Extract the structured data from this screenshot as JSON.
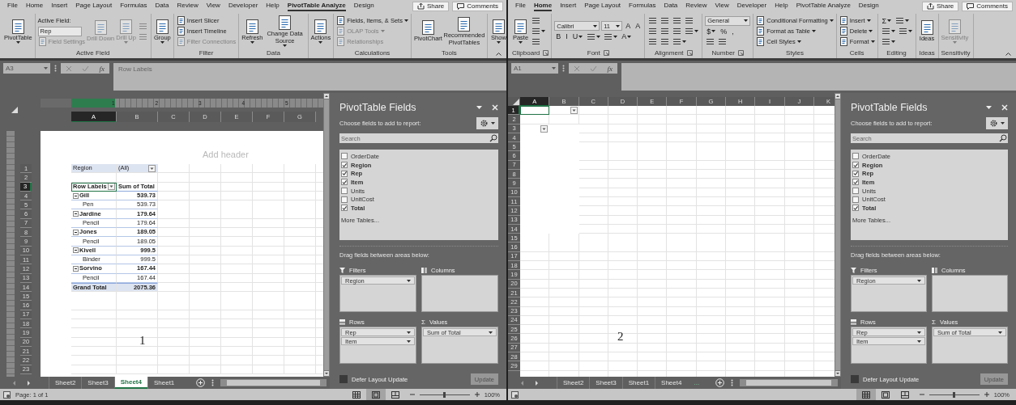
{
  "windows": [
    {
      "menu": [
        {
          "label": "File",
          "selected": false
        },
        {
          "label": "Home",
          "selected": false
        },
        {
          "label": "Insert",
          "selected": false
        },
        {
          "label": "Page Layout",
          "selected": false
        },
        {
          "label": "Formulas",
          "selected": false
        },
        {
          "label": "Data",
          "selected": false
        },
        {
          "label": "Review",
          "selected": false
        },
        {
          "label": "View",
          "selected": false
        },
        {
          "label": "Developer",
          "selected": false
        },
        {
          "label": "Help",
          "selected": false
        },
        {
          "label": "PivotTable Analyze",
          "selected": true
        },
        {
          "label": "Design",
          "selected": false
        }
      ],
      "share": "Share",
      "comments": "Comments",
      "ribbon": [
        {
          "columns": [
            [
              [
                {
                  "kind": "large",
                  "label": "PivotTable",
                  "disabled": false,
                  "caret": true
                }
              ]
            ]
          ]
        },
        {
          "label": "Active Field",
          "columns": [
            [
              [
                {
                  "kind": "text",
                  "label": "Active Field:",
                  "disabled": false
                }
              ],
              [
                {
                  "kind": "input",
                  "value": "Rep",
                  "disabled": false
                }
              ],
              [
                {
                  "kind": "small",
                  "label": "Field Settings",
                  "disabled": true
                }
              ]
            ],
            [
              [
                {
                  "kind": "large",
                  "label": "Drill Down",
                  "disabled": true
                }
              ]
            ],
            [
              [
                {
                  "kind": "large",
                  "label": "Drill Up",
                  "disabled": true,
                  "caret": true
                }
              ]
            ],
            [
              [
                {
                  "kind": "icon",
                  "disabled": true
                }
              ],
              [
                {
                  "kind": "icon",
                  "disabled": true
                }
              ]
            ]
          ]
        },
        {
          "columns": [
            [
              [
                {
                  "kind": "large",
                  "label": "Group",
                  "disabled": false,
                  "caret": true
                }
              ]
            ]
          ]
        },
        {
          "label": "Filter",
          "columns": [
            [
              [
                {
                  "kind": "small",
                  "label": "Insert Slicer",
                  "disabled": false
                }
              ],
              [
                {
                  "kind": "small",
                  "label": "Insert Timeline",
                  "disabled": false
                }
              ],
              [
                {
                  "kind": "small",
                  "label": "Filter Connections",
                  "disabled": true
                }
              ]
            ]
          ]
        },
        {
          "label": "Data",
          "columns": [
            [
              [
                {
                  "kind": "large",
                  "label": "Refresh",
                  "disabled": false,
                  "caret": true
                }
              ]
            ],
            [
              [
                {
                  "kind": "large",
                  "label": "Change Data Source",
                  "disabled": false,
                  "caret": true
                }
              ]
            ]
          ]
        },
        {
          "columns": [
            [
              [
                {
                  "kind": "large",
                  "label": "Actions",
                  "disabled": false,
                  "caret": true
                }
              ]
            ]
          ]
        },
        {
          "label": "Calculations",
          "columns": [
            [
              [
                {
                  "kind": "small",
                  "label": "Fields, Items, & Sets",
                  "disabled": false,
                  "caret": true
                }
              ],
              [
                {
                  "kind": "small",
                  "label": "OLAP Tools",
                  "disabled": true,
                  "caret": true
                }
              ],
              [
                {
                  "kind": "small",
                  "label": "Relationships",
                  "disabled": true
                }
              ]
            ]
          ]
        },
        {
          "label": "Tools",
          "columns": [
            [
              [
                {
                  "kind": "large",
                  "label": "PivotChart",
                  "disabled": false
                }
              ]
            ],
            [
              [
                {
                  "kind": "large",
                  "label": "Recommended PivotTables",
                  "disabled": false
                }
              ]
            ]
          ]
        },
        {
          "columns": [
            [
              [
                {
                  "kind": "large",
                  "label": "Show",
                  "disabled": false,
                  "caret": true
                }
              ]
            ]
          ]
        }
      ],
      "formula": {
        "name_box": "A3",
        "fx": "fx",
        "content": "Row Labels"
      },
      "sheet": {
        "kind": "page_layout",
        "ruler": [
          "1",
          "2",
          "3",
          "4",
          "5"
        ],
        "columns": [
          {
            "label": "A",
            "selected": true
          },
          {
            "label": "B",
            "selected": false
          },
          {
            "label": "C",
            "selected": false
          },
          {
            "label": "D",
            "selected": false
          },
          {
            "label": "E",
            "selected": false
          },
          {
            "label": "F",
            "selected": false
          },
          {
            "label": "G",
            "selected": false
          }
        ],
        "rows": [
          {
            "label": "1",
            "selected": false
          },
          {
            "label": "2",
            "selected": false
          },
          {
            "label": "3",
            "selected": true
          },
          {
            "label": "4",
            "selected": false
          },
          {
            "label": "5",
            "selected": false
          },
          {
            "label": "6",
            "selected": false
          },
          {
            "label": "7",
            "selected": false
          },
          {
            "label": "8",
            "selected": false
          },
          {
            "label": "9",
            "selected": false
          },
          {
            "label": "10",
            "selected": false
          },
          {
            "label": "11",
            "selected": false
          },
          {
            "label": "12",
            "selected": false
          },
          {
            "label": "13",
            "selected": false
          },
          {
            "label": "14",
            "selected": false
          },
          {
            "label": "15",
            "selected": false
          },
          {
            "label": "16",
            "selected": false
          },
          {
            "label": "17",
            "selected": false
          },
          {
            "label": "18",
            "selected": false
          },
          {
            "label": "19",
            "selected": false
          },
          {
            "label": "20",
            "selected": false
          },
          {
            "label": "21",
            "selected": false
          },
          {
            "label": "22",
            "selected": false
          },
          {
            "label": "23",
            "selected": false
          }
        ],
        "header_placeholder": "Add header",
        "pivot": {
          "kind": "report",
          "filter": {
            "field": "Region",
            "value": "(All)"
          },
          "header": {
            "label": "Row Labels",
            "value": "Sum of Total"
          },
          "rows": [
            {
              "label": "Gill",
              "value": "539.73",
              "expanded": true,
              "children": [
                {
                  "label": "Pen",
                  "value": "539.73"
                }
              ]
            },
            {
              "label": "Jardine",
              "value": "179.64",
              "expanded": true,
              "children": [
                {
                  "label": "Pencil",
                  "value": "179.64"
                }
              ]
            },
            {
              "label": "Jones",
              "value": "189.05",
              "expanded": true,
              "children": [
                {
                  "label": "Pencil",
                  "value": "189.05"
                }
              ]
            },
            {
              "label": "Kivell",
              "value": "999.5",
              "expanded": true,
              "children": [
                {
                  "label": "Binder",
                  "value": "999.5"
                }
              ]
            },
            {
              "label": "Sorvino",
              "value": "167.44",
              "expanded": true,
              "children": [
                {
                  "label": "Pencil",
                  "value": "167.44"
                }
              ]
            }
          ],
          "total": {
            "label": "Grand Total",
            "value": "2075.36"
          }
        },
        "annotation": "1"
      },
      "sheet_tabs": {
        "tabs": [
          {
            "label": "Sheet2",
            "selected": false
          },
          {
            "label": "Sheet3",
            "selected": false
          },
          {
            "label": "Sheet4",
            "selected": true
          },
          {
            "label": "Sheet1",
            "selected": false
          }
        ]
      },
      "pane": {
        "title": "PivotTable Fields",
        "subtitle": "Choose fields to add to report:",
        "search_placeholder": "Search",
        "fields": [
          {
            "label": "OrderDate",
            "checked": false
          },
          {
            "label": "Region",
            "checked": true
          },
          {
            "label": "Rep",
            "checked": true
          },
          {
            "label": "Item",
            "checked": true
          },
          {
            "label": "Units",
            "checked": false
          },
          {
            "label": "UnitCost",
            "checked": false
          },
          {
            "label": "Total",
            "checked": true
          }
        ],
        "more_tables": "More Tables...",
        "areas_hint": "Drag fields between areas below:",
        "areas": [
          {
            "kind": "filters",
            "label": "Filters",
            "items": [
              "Region"
            ]
          },
          {
            "kind": "columns",
            "label": "Columns"
          },
          {
            "kind": "rows",
            "label": "Rows",
            "items": [
              "Rep",
              "Item"
            ]
          },
          {
            "kind": "values",
            "glyph": "Σ",
            "label": "Values",
            "items": [
              "Sum of Total"
            ]
          }
        ],
        "defer": {
          "label": "Defer Layout Update",
          "checked": false
        },
        "update": {
          "label": "Update",
          "disabled": true
        }
      },
      "status": {
        "text": "Page: 1 of 1",
        "views": [
          {
            "selected": false
          },
          {
            "selected": true
          },
          {
            "selected": false
          }
        ],
        "zoom": {
          "level": 0.5,
          "label": "100%"
        }
      }
    },
    {
      "menu": [
        {
          "label": "File",
          "selected": false
        },
        {
          "label": "Home",
          "selected": true
        },
        {
          "label": "Insert",
          "selected": false
        },
        {
          "label": "Page Layout",
          "selected": false
        },
        {
          "label": "Formulas",
          "selected": false
        },
        {
          "label": "Data",
          "selected": false
        },
        {
          "label": "Review",
          "selected": false
        },
        {
          "label": "View",
          "selected": false
        },
        {
          "label": "Developer",
          "selected": false
        },
        {
          "label": "Help",
          "selected": false
        },
        {
          "label": "PivotTable Analyze",
          "selected": false
        },
        {
          "label": "Design",
          "selected": false
        }
      ],
      "share": "Share",
      "comments": "Comments",
      "ribbon": [
        {
          "label": "Clipboard",
          "launcher": true,
          "columns": [
            [
              [
                {
                  "kind": "large",
                  "label": "Paste",
                  "disabled": false,
                  "caret": true
                }
              ]
            ],
            [
              [
                {
                  "kind": "icon",
                  "disabled": false
                }
              ],
              [
                {
                  "kind": "icon",
                  "disabled": false,
                  "caret": true
                }
              ],
              [
                {
                  "kind": "icon",
                  "disabled": false
                }
              ]
            ]
          ]
        },
        {
          "label": "Font",
          "launcher": true,
          "columns": [
            [
              [
                {
                  "kind": "combo",
                  "label": "Calibri",
                  "disabled": false
                },
                {
                  "kind": "combo",
                  "label": "11",
                  "disabled": false
                },
                {
                  "kind": "glyph",
                  "label": "A",
                  "disabled": false
                },
                {
                  "kind": "glyph",
                  "label": "A",
                  "disabled": false
                }
              ],
              [
                {
                  "kind": "glyph",
                  "label": "B",
                  "disabled": false
                },
                {
                  "kind": "glyph",
                  "label": "I",
                  "disabled": false
                },
                {
                  "kind": "glyph",
                  "label": "U",
                  "disabled": false,
                  "caret": true
                },
                {
                  "kind": "icon",
                  "disabled": false,
                  "caret": true
                },
                {
                  "kind": "icon",
                  "disabled": false,
                  "caret": true
                },
                {
                  "kind": "glyph",
                  "label": "A",
                  "disabled": false,
                  "caret": true
                }
              ]
            ]
          ]
        },
        {
          "label": "Alignment",
          "launcher": true,
          "columns": [
            [
              [
                {
                  "kind": "icon",
                  "disabled": false
                },
                {
                  "kind": "icon",
                  "disabled": false
                },
                {
                  "kind": "icon",
                  "disabled": false
                },
                {
                  "kind": "icon",
                  "disabled": false
                }
              ],
              [
                {
                  "kind": "icon",
                  "disabled": false
                },
                {
                  "kind": "icon",
                  "disabled": false
                },
                {
                  "kind": "icon",
                  "disabled": false
                },
                {
                  "kind": "icon",
                  "disabled": false,
                  "caret": true
                }
              ],
              [
                {
                  "kind": "icon",
                  "disabled": false
                },
                {
                  "kind": "icon",
                  "disabled": false
                },
                {
                  "kind": "icon",
                  "disabled": false,
                  "caret": true
                }
              ]
            ]
          ]
        },
        {
          "label": "Number",
          "launcher": true,
          "columns": [
            [
              [
                {
                  "kind": "combo",
                  "label": "General",
                  "disabled": false
                }
              ],
              [
                {
                  "kind": "glyph",
                  "label": "$",
                  "disabled": false,
                  "caret": true
                },
                {
                  "kind": "glyph",
                  "label": "%",
                  "disabled": false
                },
                {
                  "kind": "glyph",
                  "label": ",",
                  "disabled": false
                }
              ],
              [
                {
                  "kind": "icon",
                  "disabled": false
                },
                {
                  "kind": "icon",
                  "disabled": false
                }
              ]
            ]
          ]
        },
        {
          "label": "Styles",
          "columns": [
            [
              [
                {
                  "kind": "small",
                  "label": "Conditional Formatting",
                  "disabled": false,
                  "caret": true
                }
              ],
              [
                {
                  "kind": "small",
                  "label": "Format as Table",
                  "disabled": false,
                  "caret": true
                }
              ],
              [
                {
                  "kind": "small",
                  "label": "Cell Styles",
                  "disabled": false,
                  "caret": true
                }
              ]
            ]
          ]
        },
        {
          "label": "Cells",
          "columns": [
            [
              [
                {
                  "kind": "small",
                  "label": "Insert",
                  "disabled": false,
                  "caret": true
                }
              ],
              [
                {
                  "kind": "small",
                  "label": "Delete",
                  "disabled": false,
                  "caret": true
                }
              ],
              [
                {
                  "kind": "small",
                  "label": "Format",
                  "disabled": false,
                  "caret": true
                }
              ]
            ]
          ]
        },
        {
          "label": "Editing",
          "columns": [
            [
              [
                {
                  "kind": "glyph",
                  "label": "Σ",
                  "disabled": false,
                  "caret": true
                },
                {
                  "kind": "icon",
                  "disabled": false,
                  "caret": true
                }
              ],
              [
                {
                  "kind": "icon",
                  "disabled": false,
                  "caret": true
                },
                {
                  "kind": "icon",
                  "disabled": false,
                  "caret": true
                }
              ],
              [
                {
                  "kind": "icon",
                  "disabled": false,
                  "caret": true
                }
              ]
            ]
          ]
        },
        {
          "label": "Ideas",
          "columns": [
            [
              [
                {
                  "kind": "large",
                  "label": "Ideas",
                  "disabled": false
                }
              ]
            ]
          ]
        },
        {
          "label": "Sensitivity",
          "columns": [
            [
              [
                {
                  "kind": "large",
                  "label": "Sensitivity",
                  "disabled": true,
                  "caret": true
                }
              ]
            ]
          ]
        }
      ],
      "formula": {
        "name_box": "A1",
        "fx": "fx"
      },
      "sheet": {
        "kind": "normal",
        "columns": [
          {
            "label": "A",
            "selected": true
          },
          {
            "label": "B",
            "selected": false
          },
          {
            "label": "C",
            "selected": false
          },
          {
            "label": "D",
            "selected": false
          },
          {
            "label": "E",
            "selected": false
          },
          {
            "label": "F",
            "selected": false
          },
          {
            "label": "G",
            "selected": false
          },
          {
            "label": "H",
            "selected": false
          },
          {
            "label": "I",
            "selected": false
          },
          {
            "label": "J",
            "selected": false
          },
          {
            "label": "K",
            "selected": false
          }
        ],
        "rows": [
          {
            "label": "1",
            "selected": true
          },
          {
            "label": "2",
            "selected": false
          },
          {
            "label": "3",
            "selected": false
          },
          {
            "label": "4",
            "selected": false
          },
          {
            "label": "5",
            "selected": false
          },
          {
            "label": "6",
            "selected": false
          },
          {
            "label": "7",
            "selected": false
          },
          {
            "label": "8",
            "selected": false
          },
          {
            "label": "9",
            "selected": false
          },
          {
            "label": "10",
            "selected": false
          },
          {
            "label": "11",
            "selected": false
          },
          {
            "label": "12",
            "selected": false
          },
          {
            "label": "13",
            "selected": false
          },
          {
            "label": "14",
            "selected": false
          },
          {
            "label": "15",
            "selected": false
          },
          {
            "label": "16",
            "selected": false
          },
          {
            "label": "17",
            "selected": false
          },
          {
            "label": "18",
            "selected": false
          },
          {
            "label": "19",
            "selected": false
          },
          {
            "label": "20",
            "selected": false
          },
          {
            "label": "21",
            "selected": false
          },
          {
            "label": "22",
            "selected": false
          },
          {
            "label": "23",
            "selected": false
          },
          {
            "label": "24",
            "selected": false
          },
          {
            "label": "25",
            "selected": false
          },
          {
            "label": "26",
            "selected": false
          },
          {
            "label": "27",
            "selected": false
          },
          {
            "label": "28",
            "selected": false
          },
          {
            "label": "29",
            "selected": false
          }
        ],
        "pivot": {
          "kind": "empty"
        },
        "annotation": "2"
      },
      "sheet_tabs": {
        "tabs": [
          {
            "label": "Sheet2",
            "selected": false
          },
          {
            "label": "Sheet3",
            "selected": false
          },
          {
            "label": "Sheet1",
            "selected": false
          },
          {
            "label": "Sheet4",
            "selected": false
          }
        ],
        "overflow": "..."
      },
      "pane": {
        "title": "PivotTable Fields",
        "subtitle": "Choose fields to add to report:",
        "search_placeholder": "Search",
        "fields": [
          {
            "label": "OrderDate",
            "checked": false
          },
          {
            "label": "Region",
            "checked": true
          },
          {
            "label": "Rep",
            "checked": true
          },
          {
            "label": "Item",
            "checked": true
          },
          {
            "label": "Units",
            "checked": false
          },
          {
            "label": "UnitCost",
            "checked": false
          },
          {
            "label": "Total",
            "checked": true
          }
        ],
        "more_tables": "More Tables...",
        "areas_hint": "Drag fields between areas below:",
        "areas": [
          {
            "kind": "filters",
            "label": "Filters",
            "items": [
              "Region"
            ]
          },
          {
            "kind": "columns",
            "label": "Columns"
          },
          {
            "kind": "rows",
            "label": "Rows",
            "items": [
              "Rep",
              "Item"
            ]
          },
          {
            "kind": "values",
            "glyph": "Σ",
            "label": "Values",
            "items": [
              "Sum of Total"
            ]
          }
        ],
        "defer": {
          "label": "Defer Layout Update",
          "checked": false
        },
        "update": {
          "label": "Update",
          "disabled": true
        }
      },
      "status": {
        "views": [
          {
            "selected": true
          },
          {
            "selected": false
          },
          {
            "selected": false
          }
        ],
        "zoom": {
          "level": 0.5,
          "label": "100%"
        }
      }
    }
  ]
}
